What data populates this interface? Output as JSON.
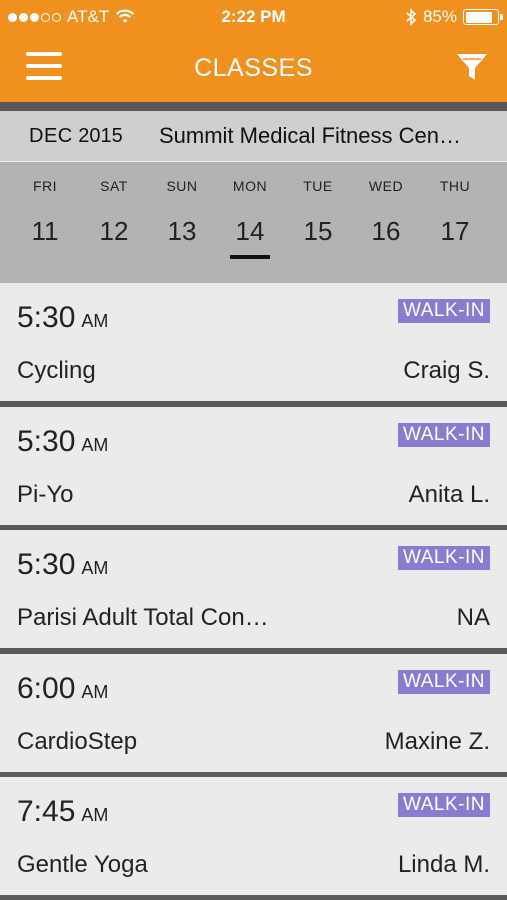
{
  "status_bar": {
    "carrier": "AT&T",
    "time": "2:22 PM",
    "battery_percent": "85%",
    "battery_level": 0.85,
    "signal_bars_filled": 3,
    "signal_bars_total": 5
  },
  "nav": {
    "title": "CLASSES",
    "menu_icon": "hamburger-menu-icon",
    "filter_icon": "filter-funnel-icon"
  },
  "date_header": {
    "month": "DEC",
    "year": "2015",
    "location": "Summit Medical Fitness Cen…"
  },
  "week": {
    "days": [
      {
        "dow": "FRI",
        "num": "11"
      },
      {
        "dow": "SAT",
        "num": "12"
      },
      {
        "dow": "SUN",
        "num": "13"
      },
      {
        "dow": "MON",
        "num": "14"
      },
      {
        "dow": "TUE",
        "num": "15"
      },
      {
        "dow": "WED",
        "num": "16"
      },
      {
        "dow": "THU",
        "num": "17"
      }
    ],
    "selected_num": "14"
  },
  "classes": [
    {
      "time": "5:30",
      "ampm": "AM",
      "badge": "WALK-IN",
      "name": "Cycling",
      "instructor": "Craig S."
    },
    {
      "time": "5:30",
      "ampm": "AM",
      "badge": "WALK-IN",
      "name": "Pi-Yo",
      "instructor": "Anita L."
    },
    {
      "time": "5:30",
      "ampm": "AM",
      "badge": "WALK-IN",
      "name": "Parisi Adult Total Con…",
      "instructor": "NA"
    },
    {
      "time": "6:00",
      "ampm": "AM",
      "badge": "WALK-IN",
      "name": "CardioStep",
      "instructor": "Maxine Z."
    },
    {
      "time": "7:45",
      "ampm": "AM",
      "badge": "WALK-IN",
      "name": "Gentle Yoga",
      "instructor": "Linda M."
    }
  ],
  "colors": {
    "accent": "#f0901f",
    "badge": "#8a7ad0"
  }
}
